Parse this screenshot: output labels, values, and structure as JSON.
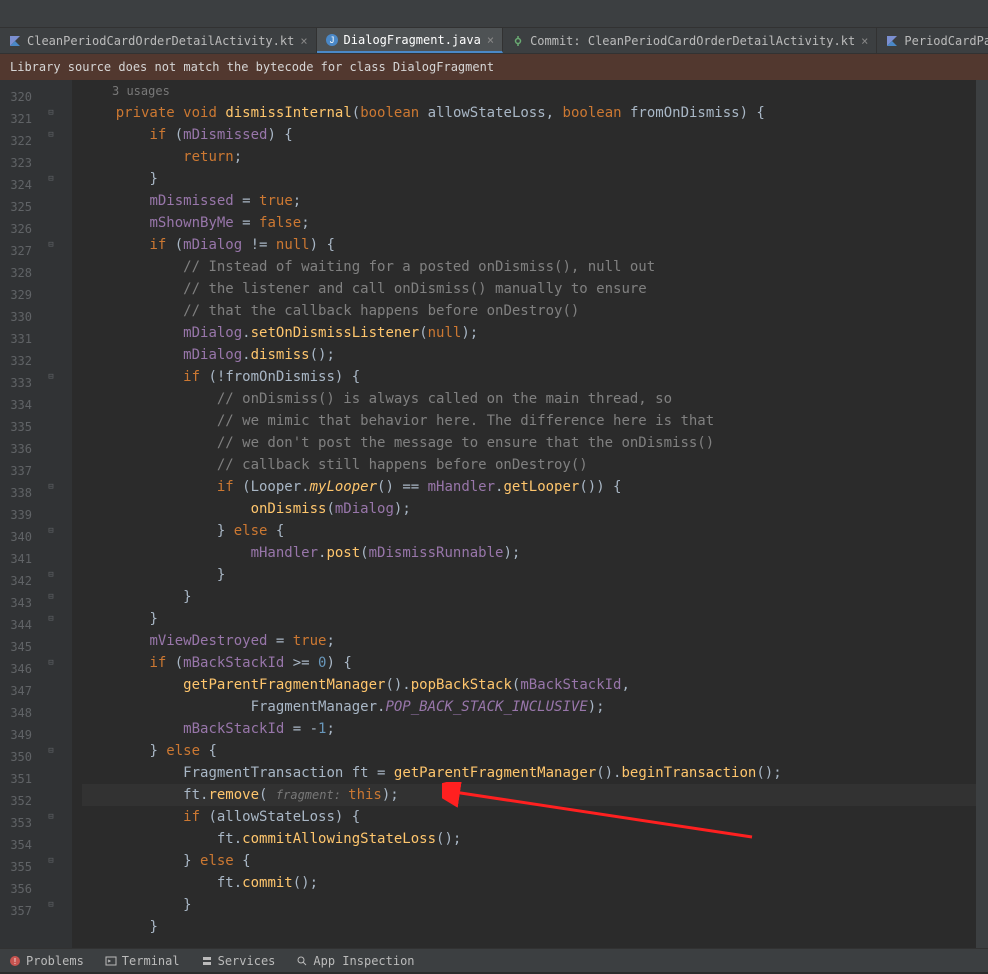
{
  "tabs": [
    {
      "label": "CleanPeriodCardOrderDetailActivity.kt",
      "icon": "kotlin",
      "active": false
    },
    {
      "label": "DialogFragment.java",
      "icon": "java",
      "active": true
    },
    {
      "label": "Commit: CleanPeriodCardOrderDetailActivity.kt",
      "icon": "git",
      "active": false
    },
    {
      "label": "PeriodCardPauseServiceDialog.kt",
      "icon": "kotlin",
      "active": false
    }
  ],
  "warning": "Library source does not match the bytecode for class DialogFragment",
  "usages_hint": "3 usages",
  "line_start": 320,
  "bottom": {
    "problems": "Problems",
    "terminal": "Terminal",
    "services": "Services",
    "app_inspection": "App Inspection"
  },
  "code": {
    "l320": {
      "kw1": "private",
      "kw2": "void",
      "fn": "dismissInternal",
      "p1t": "boolean",
      "p1": "allowStateLoss",
      "c1": ",",
      "p2t": "boolean",
      "p2": "fromOnDismiss",
      "end": ") {"
    },
    "l321": {
      "kw": "if",
      "open": " (",
      "fld": "mDismissed",
      "close": ") {"
    },
    "l322": {
      "kw": "return",
      "semi": ";"
    },
    "l323": {
      "close": "}"
    },
    "l324": {
      "fld": "mDismissed",
      "eq": " = ",
      "val": "true",
      "semi": ";"
    },
    "l325": {
      "fld": "mShownByMe",
      "eq": " = ",
      "val": "false",
      "semi": ";"
    },
    "l326": {
      "kw": "if",
      "open": " (",
      "fld": "mDialog",
      "op": " != ",
      "val": "null",
      "close": ") {"
    },
    "l327": {
      "cmt": "// Instead of waiting for a posted onDismiss(), null out"
    },
    "l328": {
      "cmt": "// the listener and call onDismiss() manually to ensure"
    },
    "l329": {
      "cmt": "// that the callback happens before onDestroy()"
    },
    "l330": {
      "fld": "mDialog",
      "dot": ".",
      "fn": "setOnDismissListener",
      "open": "(",
      "val": "null",
      "close": ");"
    },
    "l331": {
      "fld": "mDialog",
      "dot": ".",
      "fn": "dismiss",
      "close": "();"
    },
    "l332": {
      "kw": "if",
      "open": " (!",
      "var": "fromOnDismiss",
      "close": ") {"
    },
    "l333": {
      "cmt": "// onDismiss() is always called on the main thread, so"
    },
    "l334": {
      "cmt": "// we mimic that behavior here. The difference here is that"
    },
    "l335": {
      "cmt": "// we don't post the message to ensure that the onDismiss()"
    },
    "l336": {
      "cmt": "// callback still happens before onDestroy()"
    },
    "l337": {
      "kw": "if",
      "open": " (",
      "cls": "Looper",
      "dot1": ".",
      "sfn": "myLooper",
      "par": "() == ",
      "fld": "mHandler",
      "dot2": ".",
      "fn": "getLooper",
      "close": "()) {"
    },
    "l338": {
      "fn": "onDismiss",
      "open": "(",
      "fld": "mDialog",
      "close": ");"
    },
    "l339": {
      "close": "} ",
      "kw": "else",
      "open": " {"
    },
    "l340": {
      "fld": "mHandler",
      "dot": ".",
      "fn": "post",
      "open": "(",
      "fld2": "mDismissRunnable",
      "close": ");"
    },
    "l341": {
      "close": "}"
    },
    "l342": {
      "close": "}"
    },
    "l343": {
      "close": "}"
    },
    "l344": {
      "fld": "mViewDestroyed",
      "eq": " = ",
      "val": "true",
      "semi": ";"
    },
    "l345": {
      "kw": "if",
      "open": " (",
      "fld": "mBackStackId",
      "op": " >= ",
      "num": "0",
      "close": ") {"
    },
    "l346": {
      "fn": "getParentFragmentManager",
      "par": "().",
      "fn2": "popBackStack",
      "open": "(",
      "fld": "mBackStackId",
      "comma": ","
    },
    "l347": {
      "cls": "FragmentManager",
      "dot": ".",
      "sfld": "POP_BACK_STACK_INCLUSIVE",
      "close": ");"
    },
    "l348": {
      "fld": "mBackStackId",
      "eq": " = -",
      "num": "1",
      "semi": ";"
    },
    "l349": {
      "close": "} ",
      "kw": "else",
      "open": " {"
    },
    "l350": {
      "cls": "FragmentTransaction",
      "var": " ft = ",
      "fn": "getParentFragmentManager",
      "par": "().",
      "fn2": "beginTransaction",
      "close": "();"
    },
    "l351": {
      "var": "ft",
      "dot": ".",
      "fn": "remove",
      "open": "( ",
      "hint": "fragment: ",
      "kw": "this",
      "close": ");"
    },
    "l352": {
      "kw": "if",
      "open": " (",
      "var": "allowStateLoss",
      "close": ") {"
    },
    "l353": {
      "var": "ft",
      "dot": ".",
      "fn": "commitAllowingStateLoss",
      "close": "();"
    },
    "l354": {
      "close": "} ",
      "kw": "else",
      "open": " {"
    },
    "l355": {
      "var": "ft",
      "dot": ".",
      "fn": "commit",
      "close": "();"
    },
    "l356": {
      "close": "}"
    },
    "l357": {
      "close": "}"
    }
  }
}
